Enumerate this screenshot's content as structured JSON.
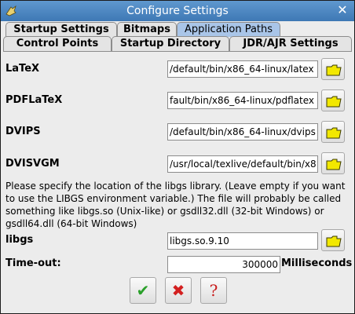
{
  "window": {
    "title": "Configure Settings"
  },
  "tabs_row1": [
    "Startup Settings",
    "Bitmaps",
    "Application Paths"
  ],
  "tabs_row2": [
    "Control Points",
    "Startup Directory",
    "JDR/AJR Settings"
  ],
  "fields": {
    "latex": {
      "label": "LaTeX",
      "value": "/default/bin/x86_64-linux/latex"
    },
    "pdflatex": {
      "label": "PDFLaTeX",
      "value": "fault/bin/x86_64-linux/pdflatex"
    },
    "dvips": {
      "label": "DVIPS",
      "value": "/default/bin/x86_64-linux/dvips"
    },
    "dvisvgm": {
      "label": "DVISVGM",
      "value": "/usr/local/texlive/default/bin/x8"
    }
  },
  "note": "Please specify the location of the libgs library. (Leave empty if you want to use the LIBGS environment variable.) The file will probably be called something like libgs.so (Unix-like) or gsdll32.dll (32-bit Windows) or gsdll64.dll (64-bit Windows)",
  "libgs": {
    "label": "libgs",
    "value": "libgs.so.9.10"
  },
  "timeout": {
    "label": "Time-out:",
    "value": "300000",
    "unit": "Milliseconds"
  },
  "buttons": {
    "ok": "✔",
    "cancel": "✖",
    "help": "?"
  },
  "colors": {
    "title_bar": "#4a86c3",
    "active_tab": "#a9c5e8",
    "folder": "#f2e800",
    "ok": "#2aa02a",
    "cancel": "#d32020",
    "help": "#c81c1c"
  }
}
